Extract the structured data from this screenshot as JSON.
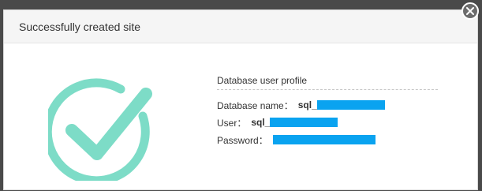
{
  "dialog": {
    "title": "Successfully created site",
    "close_icon": "close-icon"
  },
  "success_icon": {
    "name": "check-circle-icon",
    "color": "#7ddcc7"
  },
  "profile": {
    "section_title": "Database user profile",
    "fields": {
      "database_name": {
        "label": "Database name：",
        "value": "sql_"
      },
      "user": {
        "label": "User：",
        "value": "sql_"
      },
      "password": {
        "label": "Password：",
        "value": ""
      }
    },
    "redaction_color": "#0aa3f0"
  }
}
